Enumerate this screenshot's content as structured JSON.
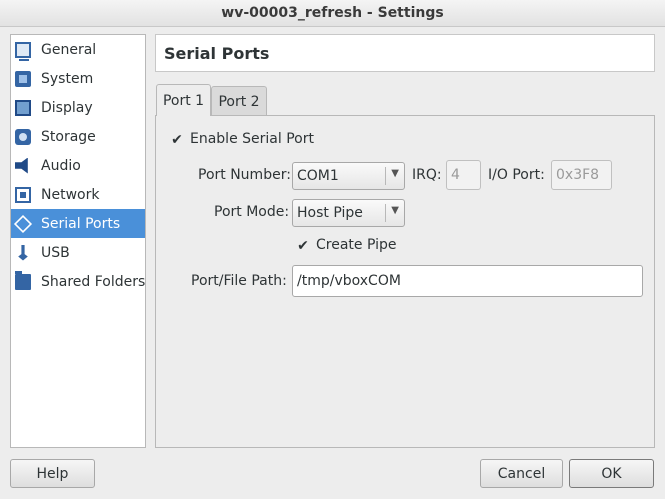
{
  "window": {
    "title": "wv-00003_refresh - Settings"
  },
  "sidebar": {
    "items": [
      {
        "label": "General",
        "icon": "general-icon"
      },
      {
        "label": "System",
        "icon": "system-icon"
      },
      {
        "label": "Display",
        "icon": "display-icon"
      },
      {
        "label": "Storage",
        "icon": "storage-icon"
      },
      {
        "label": "Audio",
        "icon": "audio-icon"
      },
      {
        "label": "Network",
        "icon": "network-icon"
      },
      {
        "label": "Serial Ports",
        "icon": "serial-ports-icon",
        "selected": true
      },
      {
        "label": "USB",
        "icon": "usb-icon"
      },
      {
        "label": "Shared Folders",
        "icon": "shared-folders-icon"
      }
    ],
    "selected_color": "#4a90d9"
  },
  "page": {
    "title": "Serial Ports"
  },
  "tabs": [
    {
      "label": "Port 1",
      "active": true
    },
    {
      "label": "Port 2",
      "active": false
    }
  ],
  "form": {
    "enable_serial_port": {
      "label": "Enable Serial Port",
      "checked": true
    },
    "port_number": {
      "label": "Port Number:",
      "value": "COM1"
    },
    "irq": {
      "label": "IRQ:",
      "value": "4"
    },
    "io_port": {
      "label": "I/O Port:",
      "value": "0x3F8"
    },
    "port_mode": {
      "label": "Port Mode:",
      "value": "Host Pipe"
    },
    "create_pipe": {
      "label": "Create Pipe",
      "checked": true
    },
    "port_file_path": {
      "label": "Port/File Path:",
      "value": "/tmp/vboxCOM"
    }
  },
  "buttons": {
    "help": "Help",
    "cancel": "Cancel",
    "ok": "OK"
  }
}
